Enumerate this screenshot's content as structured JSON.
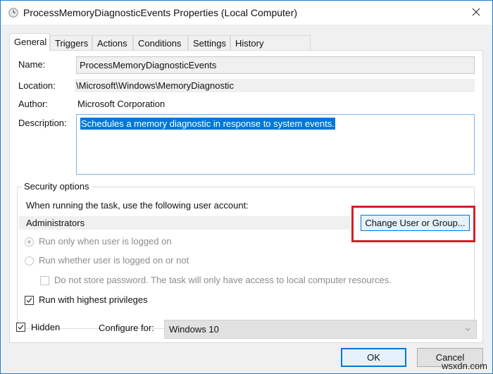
{
  "window": {
    "title": "ProcessMemoryDiagnosticEvents Properties (Local Computer)",
    "icon": "clock-task-icon",
    "close_icon": "close-icon"
  },
  "tabs": [
    {
      "label": "General",
      "active": true
    },
    {
      "label": "Triggers",
      "active": false
    },
    {
      "label": "Actions",
      "active": false
    },
    {
      "label": "Conditions",
      "active": false
    },
    {
      "label": "Settings",
      "active": false
    },
    {
      "label": "History (disabled)",
      "active": false
    }
  ],
  "general": {
    "name_label": "Name:",
    "name_value": "ProcessMemoryDiagnosticEvents",
    "location_label": "Location:",
    "location_value": "\\Microsoft\\Windows\\MemoryDiagnostic",
    "author_label": "Author:",
    "author_value": "Microsoft Corporation",
    "description_label": "Description:",
    "description_value": "Schedules a memory diagnostic in response to system events."
  },
  "security": {
    "title": "Security options",
    "account_prompt": "When running the task, use the following user account:",
    "account_value": "Administrators",
    "change_button": "Change User or Group...",
    "radio_logged_on": {
      "label": "Run only when user is logged on",
      "checked": true,
      "enabled": false
    },
    "radio_whether": {
      "label": "Run whether user is logged on or not",
      "checked": false,
      "enabled": false
    },
    "no_store_password": {
      "label": "Do not store password.  The task will only have access to local computer resources.",
      "checked": false,
      "enabled": false
    },
    "highest_privileges": {
      "label": "Run with highest privileges",
      "checked": true
    }
  },
  "footer": {
    "hidden": {
      "label": "Hidden",
      "checked": true
    },
    "configure_label": "Configure for:",
    "configure_value": "Windows 10",
    "ok_button": "OK",
    "cancel_button": "Cancel"
  },
  "highlight_color": "#d0202a",
  "accent_color": "#0078d7",
  "watermark": "wsxdn.com"
}
